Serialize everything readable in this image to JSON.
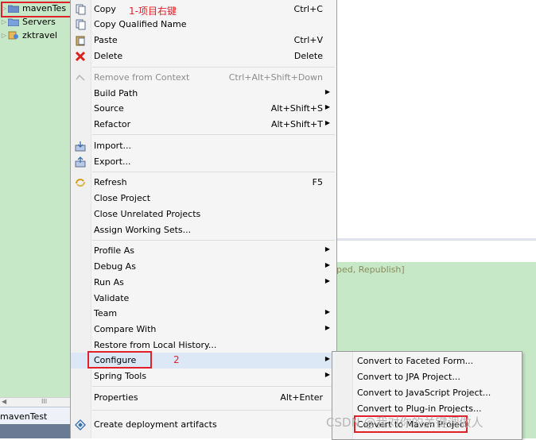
{
  "explorer": {
    "items": [
      {
        "label": "mavenTes",
        "icon": "maven-project-icon"
      },
      {
        "label": "Servers",
        "icon": "folder-icon"
      },
      {
        "label": "zktravel",
        "icon": "web-project-icon"
      }
    ],
    "scroll_grip": "III",
    "tab_label": "mavenTest"
  },
  "status_fragment": "ped, Republish]",
  "menu": {
    "annotation1": "1-项目右键",
    "annotation2": "2",
    "items": [
      {
        "label": "Copy",
        "shortcut": "Ctrl+C",
        "icon": "copy-icon"
      },
      {
        "label": "Copy Qualified Name",
        "shortcut": "",
        "icon": "copy-qualified-icon"
      },
      {
        "label": "Paste",
        "shortcut": "Ctrl+V",
        "icon": "paste-icon"
      },
      {
        "label": "Delete",
        "shortcut": "Delete",
        "icon": "delete-icon"
      },
      {
        "label": "Remove from Context",
        "shortcut": "Ctrl+Alt+Shift+Down",
        "icon": "remove-context-icon",
        "disabled": true
      },
      {
        "label": "Build Path",
        "shortcut": "",
        "submenu": true
      },
      {
        "label": "Source",
        "shortcut": "Alt+Shift+S",
        "submenu": true
      },
      {
        "label": "Refactor",
        "shortcut": "Alt+Shift+T",
        "submenu": true
      },
      {
        "label": "Import...",
        "icon": "import-icon"
      },
      {
        "label": "Export...",
        "icon": "export-icon"
      },
      {
        "label": "Refresh",
        "shortcut": "F5",
        "icon": "refresh-icon"
      },
      {
        "label": "Close Project"
      },
      {
        "label": "Close Unrelated Projects"
      },
      {
        "label": "Assign Working Sets..."
      },
      {
        "label": "Profile As",
        "submenu": true
      },
      {
        "label": "Debug As",
        "submenu": true
      },
      {
        "label": "Run As",
        "submenu": true
      },
      {
        "label": "Validate"
      },
      {
        "label": "Team",
        "submenu": true
      },
      {
        "label": "Compare With",
        "submenu": true
      },
      {
        "label": "Restore from Local History..."
      },
      {
        "label": "Configure",
        "submenu": true
      },
      {
        "label": "Spring Tools",
        "submenu": true
      },
      {
        "label": "Properties",
        "shortcut": "Alt+Enter"
      },
      {
        "label": "Create deployment artifacts",
        "icon": "deploy-icon"
      }
    ],
    "submenu_arrow": "▶"
  },
  "submenu": {
    "items": [
      {
        "label": "Convert to Faceted Form..."
      },
      {
        "label": "Convert to JPA Project..."
      },
      {
        "label": "Convert to JavaScript Project..."
      },
      {
        "label": "Convert to Plug-in Projects..."
      },
      {
        "label": "Convert to Maven Project"
      }
    ]
  },
  "watermark": "CSDN @我对你的关键调做人",
  "colors": {
    "annotation_red": "#e0202a",
    "explorer_bg": "#c6e8c6",
    "menu_bg": "#f5f5f5"
  }
}
